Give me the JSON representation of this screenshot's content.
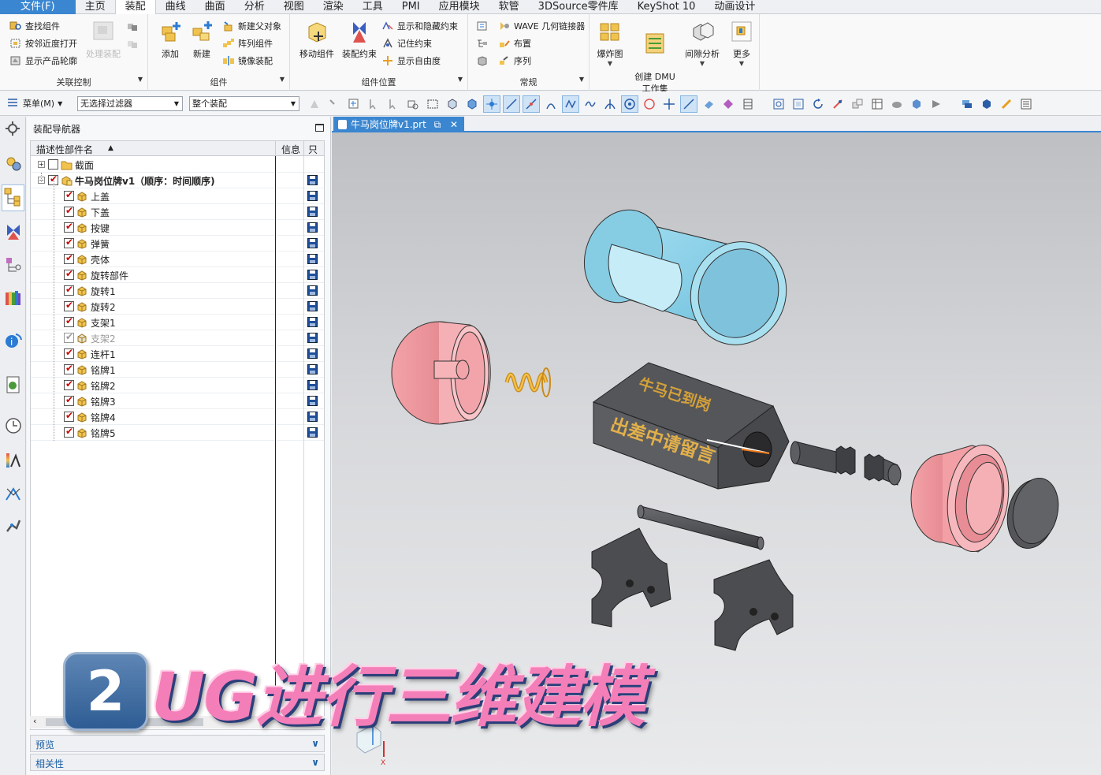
{
  "menu": {
    "items": [
      "文件(F)",
      "主页",
      "装配",
      "曲线",
      "曲面",
      "分析",
      "视图",
      "渲染",
      "工具",
      "PMI",
      "应用模块",
      "软管",
      "3DSource零件库",
      "KeyShot 10",
      "动画设计"
    ]
  },
  "ribbon": {
    "group1": {
      "label": "关联控制",
      "cmds": [
        "查找组件",
        "按邻近度打开",
        "显示产品轮廓"
      ],
      "big_disabled": "处理装配"
    },
    "group2": {
      "label": "组件",
      "big": [
        "添加",
        "新建"
      ],
      "cmds": [
        "新建父对象",
        "阵列组件",
        "镜像装配"
      ]
    },
    "group3": {
      "label": "组件位置",
      "big": [
        "移动组件",
        "装配约束"
      ],
      "cmds": [
        "显示和隐藏约束",
        "记住约束",
        "显示自由度"
      ]
    },
    "group4": {
      "label": "常规",
      "cmds": [
        "WAVE 几何链接器",
        "布置",
        "序列"
      ]
    },
    "group5": {
      "big": [
        "爆炸图",
        "创建 DMU\n工作集",
        "间隙分析",
        "更多"
      ]
    }
  },
  "toolbar": {
    "menu_label": "菜单(M)",
    "filter_value": "无选择过滤器",
    "scope_value": "整个装配"
  },
  "navigator": {
    "title": "装配导航器",
    "columns": {
      "name": "描述性部件名",
      "info": "信息",
      "readonly": "只"
    },
    "rows": [
      {
        "label": "截面",
        "level": 0,
        "expand": "+",
        "checked": false,
        "type": "folder"
      },
      {
        "label": "牛马岗位牌v1（顺序：时间顺序)",
        "level": 0,
        "expand": "-",
        "checked": true,
        "type": "assembly"
      },
      {
        "label": "上盖",
        "level": 1,
        "checked": true,
        "type": "part"
      },
      {
        "label": "下盖",
        "level": 1,
        "checked": true,
        "type": "part"
      },
      {
        "label": "按键",
        "level": 1,
        "checked": true,
        "type": "part"
      },
      {
        "label": "弹簧",
        "level": 1,
        "checked": true,
        "type": "part"
      },
      {
        "label": "壳体",
        "level": 1,
        "checked": true,
        "type": "part"
      },
      {
        "label": "旋转部件",
        "level": 1,
        "checked": true,
        "type": "part"
      },
      {
        "label": "旋转1",
        "level": 1,
        "checked": true,
        "type": "part"
      },
      {
        "label": "旋转2",
        "level": 1,
        "checked": true,
        "type": "part"
      },
      {
        "label": "支架1",
        "level": 1,
        "checked": true,
        "type": "part"
      },
      {
        "label": "支架2",
        "level": 1,
        "checked": true,
        "type": "part",
        "grayed": true
      },
      {
        "label": "连杆1",
        "level": 1,
        "checked": true,
        "type": "part"
      },
      {
        "label": "铭牌1",
        "level": 1,
        "checked": true,
        "type": "part"
      },
      {
        "label": "铭牌2",
        "level": 1,
        "checked": true,
        "type": "part"
      },
      {
        "label": "铭牌3",
        "level": 1,
        "checked": true,
        "type": "part"
      },
      {
        "label": "铭牌4",
        "level": 1,
        "checked": true,
        "type": "part"
      },
      {
        "label": "铭牌5",
        "level": 1,
        "checked": true,
        "type": "part"
      }
    ],
    "panels": [
      "预览",
      "相关性"
    ]
  },
  "graphics": {
    "tab_label": "牛马岗位牌v1.prt",
    "engraving_top": "牛马已到岗",
    "engraving_side": "出差中请留言",
    "triad_axis": "X"
  },
  "overlay": {
    "badge": "2",
    "text": "UG进行三维建模"
  },
  "colors": {
    "accent": "#3a86d0",
    "sleeve": "#8ed3ea",
    "pink_part": "#f1959b",
    "dark_part": "#4a4b4e",
    "spring": "#e9a524",
    "banner_text": "#f47fb8"
  }
}
